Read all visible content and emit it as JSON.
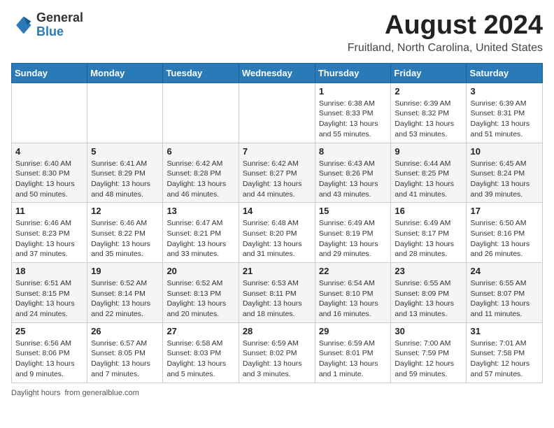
{
  "header": {
    "logo_general": "General",
    "logo_blue": "Blue",
    "month_year": "August 2024",
    "location": "Fruitland, North Carolina, United States"
  },
  "days_of_week": [
    "Sunday",
    "Monday",
    "Tuesday",
    "Wednesday",
    "Thursday",
    "Friday",
    "Saturday"
  ],
  "weeks": [
    [
      {
        "day": "",
        "info": ""
      },
      {
        "day": "",
        "info": ""
      },
      {
        "day": "",
        "info": ""
      },
      {
        "day": "",
        "info": ""
      },
      {
        "day": "1",
        "info": "Sunrise: 6:38 AM\nSunset: 8:33 PM\nDaylight: 13 hours and 55 minutes."
      },
      {
        "day": "2",
        "info": "Sunrise: 6:39 AM\nSunset: 8:32 PM\nDaylight: 13 hours and 53 minutes."
      },
      {
        "day": "3",
        "info": "Sunrise: 6:39 AM\nSunset: 8:31 PM\nDaylight: 13 hours and 51 minutes."
      }
    ],
    [
      {
        "day": "4",
        "info": "Sunrise: 6:40 AM\nSunset: 8:30 PM\nDaylight: 13 hours and 50 minutes."
      },
      {
        "day": "5",
        "info": "Sunrise: 6:41 AM\nSunset: 8:29 PM\nDaylight: 13 hours and 48 minutes."
      },
      {
        "day": "6",
        "info": "Sunrise: 6:42 AM\nSunset: 8:28 PM\nDaylight: 13 hours and 46 minutes."
      },
      {
        "day": "7",
        "info": "Sunrise: 6:42 AM\nSunset: 8:27 PM\nDaylight: 13 hours and 44 minutes."
      },
      {
        "day": "8",
        "info": "Sunrise: 6:43 AM\nSunset: 8:26 PM\nDaylight: 13 hours and 43 minutes."
      },
      {
        "day": "9",
        "info": "Sunrise: 6:44 AM\nSunset: 8:25 PM\nDaylight: 13 hours and 41 minutes."
      },
      {
        "day": "10",
        "info": "Sunrise: 6:45 AM\nSunset: 8:24 PM\nDaylight: 13 hours and 39 minutes."
      }
    ],
    [
      {
        "day": "11",
        "info": "Sunrise: 6:46 AM\nSunset: 8:23 PM\nDaylight: 13 hours and 37 minutes."
      },
      {
        "day": "12",
        "info": "Sunrise: 6:46 AM\nSunset: 8:22 PM\nDaylight: 13 hours and 35 minutes."
      },
      {
        "day": "13",
        "info": "Sunrise: 6:47 AM\nSunset: 8:21 PM\nDaylight: 13 hours and 33 minutes."
      },
      {
        "day": "14",
        "info": "Sunrise: 6:48 AM\nSunset: 8:20 PM\nDaylight: 13 hours and 31 minutes."
      },
      {
        "day": "15",
        "info": "Sunrise: 6:49 AM\nSunset: 8:19 PM\nDaylight: 13 hours and 29 minutes."
      },
      {
        "day": "16",
        "info": "Sunrise: 6:49 AM\nSunset: 8:17 PM\nDaylight: 13 hours and 28 minutes."
      },
      {
        "day": "17",
        "info": "Sunrise: 6:50 AM\nSunset: 8:16 PM\nDaylight: 13 hours and 26 minutes."
      }
    ],
    [
      {
        "day": "18",
        "info": "Sunrise: 6:51 AM\nSunset: 8:15 PM\nDaylight: 13 hours and 24 minutes."
      },
      {
        "day": "19",
        "info": "Sunrise: 6:52 AM\nSunset: 8:14 PM\nDaylight: 13 hours and 22 minutes."
      },
      {
        "day": "20",
        "info": "Sunrise: 6:52 AM\nSunset: 8:13 PM\nDaylight: 13 hours and 20 minutes."
      },
      {
        "day": "21",
        "info": "Sunrise: 6:53 AM\nSunset: 8:11 PM\nDaylight: 13 hours and 18 minutes."
      },
      {
        "day": "22",
        "info": "Sunrise: 6:54 AM\nSunset: 8:10 PM\nDaylight: 13 hours and 16 minutes."
      },
      {
        "day": "23",
        "info": "Sunrise: 6:55 AM\nSunset: 8:09 PM\nDaylight: 13 hours and 13 minutes."
      },
      {
        "day": "24",
        "info": "Sunrise: 6:55 AM\nSunset: 8:07 PM\nDaylight: 13 hours and 11 minutes."
      }
    ],
    [
      {
        "day": "25",
        "info": "Sunrise: 6:56 AM\nSunset: 8:06 PM\nDaylight: 13 hours and 9 minutes."
      },
      {
        "day": "26",
        "info": "Sunrise: 6:57 AM\nSunset: 8:05 PM\nDaylight: 13 hours and 7 minutes."
      },
      {
        "day": "27",
        "info": "Sunrise: 6:58 AM\nSunset: 8:03 PM\nDaylight: 13 hours and 5 minutes."
      },
      {
        "day": "28",
        "info": "Sunrise: 6:59 AM\nSunset: 8:02 PM\nDaylight: 13 hours and 3 minutes."
      },
      {
        "day": "29",
        "info": "Sunrise: 6:59 AM\nSunset: 8:01 PM\nDaylight: 13 hours and 1 minute."
      },
      {
        "day": "30",
        "info": "Sunrise: 7:00 AM\nSunset: 7:59 PM\nDaylight: 12 hours and 59 minutes."
      },
      {
        "day": "31",
        "info": "Sunrise: 7:01 AM\nSunset: 7:58 PM\nDaylight: 12 hours and 57 minutes."
      }
    ]
  ],
  "footer": {
    "daylight_hours": "Daylight hours",
    "source": "generalblue.com"
  }
}
